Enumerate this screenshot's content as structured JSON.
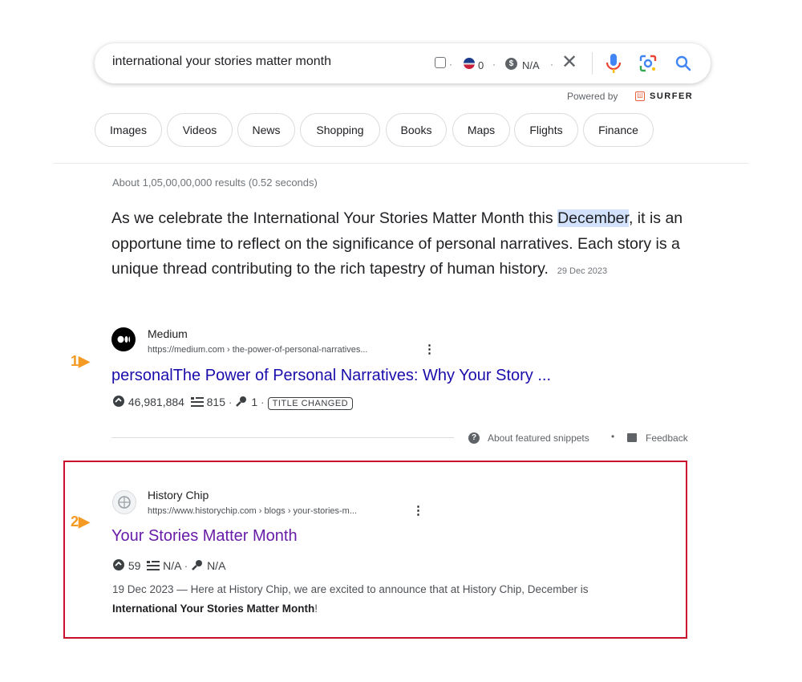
{
  "search": {
    "query": "international your stories matter month",
    "flag_count": "0",
    "cpc": "N/A",
    "separator": "·"
  },
  "powered_by": {
    "label": "Powered by",
    "brand": "SURFER"
  },
  "chips": [
    "Images",
    "Videos",
    "News",
    "Shopping",
    "Books",
    "Maps",
    "Flights",
    "Finance"
  ],
  "result_stats": "About 1,05,00,00,000 results (0.52 seconds)",
  "featured_snippet": {
    "before": "As we celebrate the International Your Stories Matter Month this ",
    "highlight": "December",
    "after": ", it is an opportune time to reflect on the significance of personal narratives. Each story is a unique thread contributing to the rich tapestry of human history.",
    "date": "29 Dec 2023",
    "about_label": "About featured snippets",
    "feedback_label": "Feedback"
  },
  "results": [
    {
      "rank": "1",
      "site": "Medium",
      "url": "https://medium.com › the-power-of-personal-narratives...",
      "title": "personalThe Power of Personal Narratives: Why Your Story ...",
      "traffic": "46,981,884",
      "keywords": "815",
      "backlinks": "1",
      "badge": "TITLE CHANGED"
    },
    {
      "rank": "2",
      "site": "History Chip",
      "url": "https://www.historychip.com › blogs › your-stories-m...",
      "title": "Your Stories Matter Month",
      "traffic": "59",
      "keywords": "N/A",
      "backlinks": "N/A",
      "date": "19 Dec 2023 —",
      "desc_before": "Here at History Chip, we are excited to announce that at History Chip, December is ",
      "desc_bold": "International Your Stories Matter Month",
      "desc_after": "!"
    }
  ],
  "colors": {
    "link": "#1a0dab",
    "visited_link": "#681da8",
    "rank_arrow": "#f59a23",
    "highlight_box": "#c8102e",
    "mic_blue": "#4285f4"
  },
  "icons": [
    "check-box-icon",
    "us-flag-icon",
    "dollar-icon",
    "close-icon",
    "mic-icon",
    "google-lens-icon",
    "search-icon",
    "surfer-logo-icon",
    "traffic-icon",
    "keywords-list-icon",
    "backlink-key-icon",
    "kebab-menu-icon",
    "help-icon",
    "feedback-icon",
    "rank-arrow-icon"
  ]
}
